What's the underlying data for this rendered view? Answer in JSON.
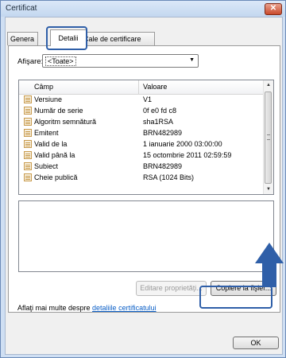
{
  "window": {
    "title": "Certificat",
    "close_glyph": "✕"
  },
  "tabs": [
    {
      "label": "Genera"
    },
    {
      "label": "Detalii"
    },
    {
      "label": "Cale de certificare"
    }
  ],
  "show": {
    "label": "Afişare:",
    "value": "<Toate>"
  },
  "list": {
    "columns": [
      "Câmp",
      "Valoare"
    ],
    "rows": [
      {
        "field": "Versiune",
        "value": "V1"
      },
      {
        "field": "Număr de serie",
        "value": "0f e0 fd c8"
      },
      {
        "field": "Algoritm semnătură",
        "value": "sha1RSA"
      },
      {
        "field": "Emitent",
        "value": "BRN482989"
      },
      {
        "field": "Valid de la",
        "value": "1 ianuarie 2000 03:00:00"
      },
      {
        "field": "Valid până la",
        "value": "15 octombrie 2011 02:59:59"
      },
      {
        "field": "Subiect",
        "value": "BRN482989"
      },
      {
        "field": "Cheie publică",
        "value": "RSA (1024 Bits)"
      }
    ]
  },
  "buttons": {
    "edit_label": "Editare proprietăţi...",
    "copy_label": "Copiere la fişier...",
    "ok_label": "OK"
  },
  "more": {
    "text": "Aflaţi mai multe despre ",
    "link": "detaliile certificatului"
  },
  "colors": {
    "highlight": "#2f5fa8",
    "link": "#0b5fc7"
  }
}
